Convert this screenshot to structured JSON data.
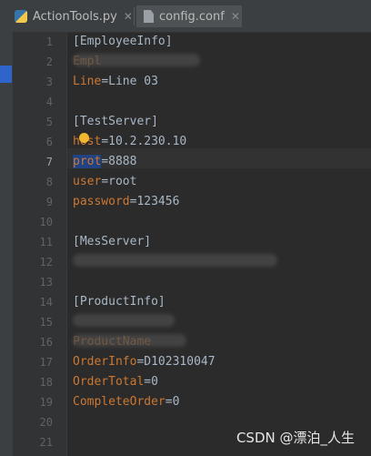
{
  "tabs": [
    {
      "label": "ActionTools.py",
      "icon": "python-file-icon",
      "closable": true
    },
    {
      "label": "config.conf",
      "icon": "config-file-icon",
      "closable": true,
      "active": true
    }
  ],
  "editor": {
    "current_line": 7,
    "lines": [
      {
        "n": "1",
        "text": "[EmployeeInfo]"
      },
      {
        "n": "2",
        "key": "Empl",
        "redacted": true
      },
      {
        "n": "3",
        "key": "Line",
        "value": "Line 03"
      },
      {
        "n": "4"
      },
      {
        "n": "5",
        "text": "[TestServer]"
      },
      {
        "n": "6",
        "key": "host",
        "value": "10.2.230.10"
      },
      {
        "n": "7",
        "key": "prot",
        "value": "8888"
      },
      {
        "n": "8",
        "key": "user",
        "value": "root"
      },
      {
        "n": "9",
        "key": "password",
        "value": "123456"
      },
      {
        "n": "10"
      },
      {
        "n": "11",
        "text": "[MesServer]"
      },
      {
        "n": "12",
        "redacted": true
      },
      {
        "n": "13"
      },
      {
        "n": "14",
        "text": "[ProductInfo]"
      },
      {
        "n": "15",
        "redacted": true
      },
      {
        "n": "16",
        "key": "ProductName",
        "redacted": true
      },
      {
        "n": "17",
        "key": "OrderInfo",
        "value": "D102310047"
      },
      {
        "n": "18",
        "key": "OrderTotal",
        "value": "0"
      },
      {
        "n": "19",
        "key": "CompleteOrder",
        "value": "0"
      },
      {
        "n": "20"
      },
      {
        "n": "21"
      }
    ]
  },
  "watermark": "CSDN @漂泊_人生",
  "colors": {
    "key": "#cc7832",
    "text": "#a9b7c6",
    "selection": "#214283",
    "background": "#2b2b2b"
  }
}
